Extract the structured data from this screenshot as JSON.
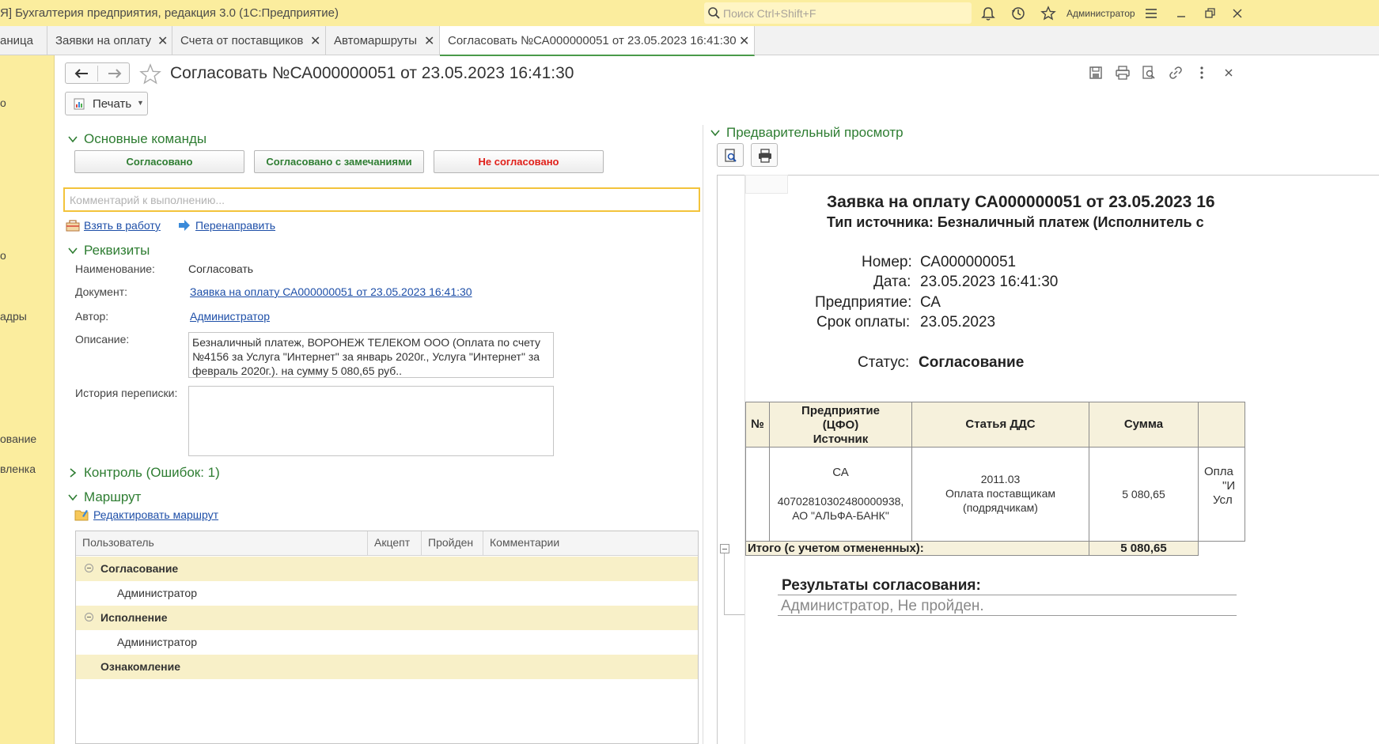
{
  "app": {
    "title": "Я] Бухгалтерия предприятия, редакция 3.0  (1С:Предприятие)",
    "search_placeholder": "Поиск Ctrl+Shift+F",
    "user": "Администратор"
  },
  "tabs": [
    {
      "label": "аница"
    },
    {
      "label": "Заявки на оплату"
    },
    {
      "label": "Счета от поставщиков"
    },
    {
      "label": "Автомаршруты"
    },
    {
      "label": "Согласовать №СА000000051 от 23.05.2023 16:41:30"
    }
  ],
  "left_panel": [
    "о",
    "о",
    "адры",
    "ование",
    "вленка"
  ],
  "document": {
    "title": "Согласовать №СА000000051 от 23.05.2023 16:41:30",
    "print_label": "Печать"
  },
  "main_commands": {
    "title": "Основные команды",
    "approved": "Согласовано",
    "approved_remarks": "Согласовано с замечаниями",
    "not_approved": "Не согласовано",
    "comment_placeholder": "Комментарий к выполнению...",
    "take_to_work": "Взять в работу",
    "redirect": "Перенаправить"
  },
  "requisites": {
    "title": "Реквизиты",
    "name_label": "Наименование:",
    "name_value": "Согласовать",
    "doc_label": "Документ:",
    "doc_value": "Заявка на оплату СА000000051 от 23.05.2023 16:41:30",
    "author_label": "Автор:",
    "author_value": "Администратор",
    "desc_label": "Описание:",
    "desc_value": "Безналичный платеж, ВОРОНЕЖ ТЕЛЕКОМ ООО (Оплата по счету №4156 за Услуга \"Интернет\" за январь 2020г., Услуга \"Интернет\" за февраль 2020г.).  на сумму 5 080,65 руб..",
    "history_label": "История переписки:"
  },
  "control": {
    "title": "Контроль (Ошибок: 1)"
  },
  "route": {
    "title": "Маршрут",
    "edit_link": "Редактировать маршрут",
    "columns": [
      "Пользователь",
      "Акцепт",
      "Пройден",
      "Комментарии"
    ],
    "rows": [
      {
        "type": "group",
        "text": "Согласование"
      },
      {
        "type": "user",
        "text": "Администратор"
      },
      {
        "type": "group",
        "text": "Исполнение"
      },
      {
        "type": "user",
        "text": "Администратор"
      },
      {
        "type": "group",
        "text": "Ознакомление"
      }
    ]
  },
  "preview": {
    "title": "Предварительный просмотр",
    "report_title": "Заявка на оплату СА000000051 от 23.05.2023 16",
    "source_type": "Тип источника: Безналичный платеж (Исполнитель с",
    "number_label": "Номер:",
    "number_value": "СА000000051",
    "date_label": "Дата:",
    "date_value": "23.05.2023 16:41:30",
    "company_label": "Предприятие:",
    "company_value": "СА",
    "due_label": "Срок оплаты:",
    "due_value": "23.05.2023",
    "status_label": "Статус:",
    "status_value": "Согласование",
    "table": {
      "h_num": "№",
      "h_company_1": "Предприятие",
      "h_company_2": "(ЦФО)",
      "h_company_3": "Источник",
      "h_article": "Статья ДДС",
      "h_sum": "Сумма",
      "row_company": "СА",
      "row_account": "40702810302480000938,",
      "row_bank": "АО \"АЛЬФА-БАНК\"",
      "row_article_code": "2011.03",
      "row_article_1": "Оплата поставщикам",
      "row_article_2": "(подрядчикам)",
      "row_sum": "5 080,65",
      "row_extra_1": "Опла",
      "row_extra_2": "\"И",
      "row_extra_3": "Усл",
      "total_label": "Итого (с учетом отмененных):",
      "total_value": "5 080,65"
    },
    "results_title": "Результаты согласования:",
    "results_value": "Администратор, Не пройден."
  },
  "colors": {
    "titlebar": "#fbed9e",
    "section_green": "#2e7d32",
    "approved_text": "#2e7d32",
    "not_approved_text": "#e0201a",
    "link": "#1e4fa8",
    "focus_border": "#f3c33b"
  }
}
